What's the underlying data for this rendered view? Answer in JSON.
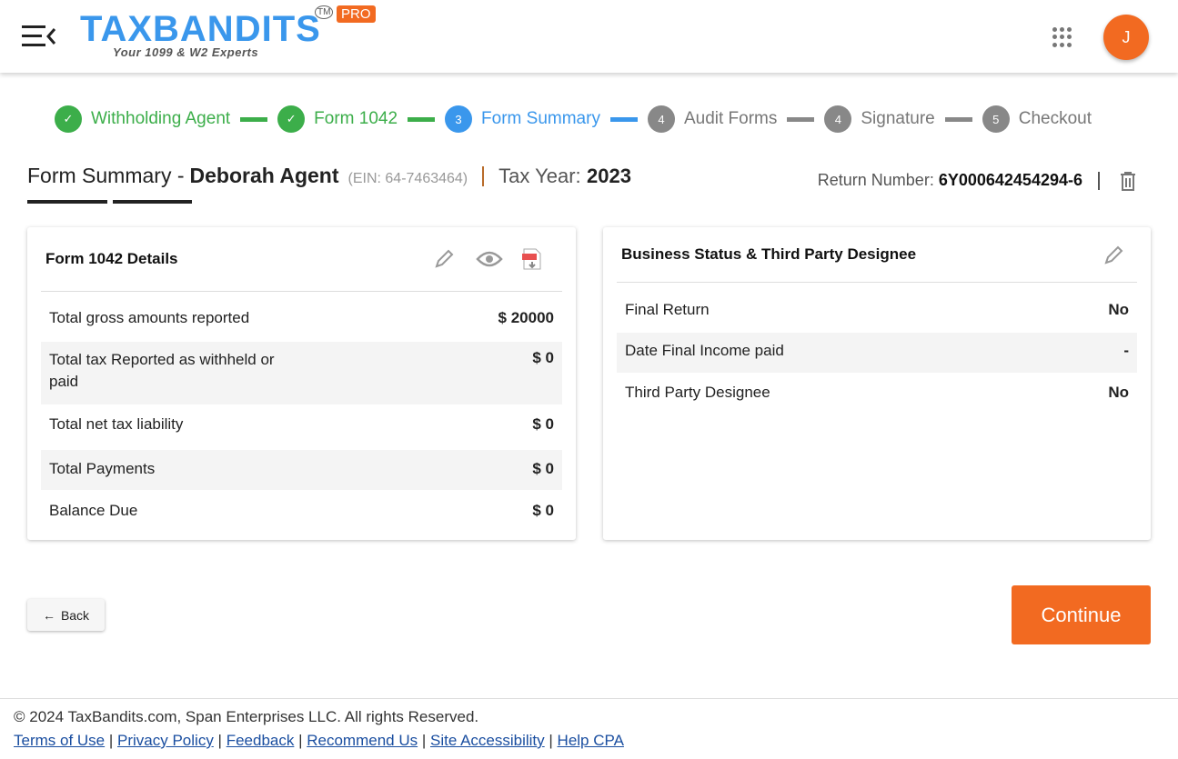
{
  "header": {
    "brand": "TAXBANDITS",
    "tagline": "Your 1099 & W2 Experts",
    "tm": "TM",
    "pro": "PRO",
    "avatar_initial": "J"
  },
  "steps": [
    {
      "label": "Withholding Agent",
      "num": "✓",
      "state": "done"
    },
    {
      "label": "Form 1042",
      "num": "✓",
      "state": "done"
    },
    {
      "label": "Form Summary",
      "num": "3",
      "state": "current"
    },
    {
      "label": "Audit Forms",
      "num": "4",
      "state": "todo"
    },
    {
      "label": "Signature",
      "num": "4",
      "state": "todo"
    },
    {
      "label": "Checkout",
      "num": "5",
      "state": "todo"
    }
  ],
  "title": {
    "prefix": "Form Summary -",
    "name": "Deborah Agent",
    "ein": "(EIN: 64-7463464)",
    "tax_year_label": "Tax Year:",
    "tax_year": "2023",
    "return_label": "Return Number:",
    "return_number": "6Y000642454294-6"
  },
  "details": {
    "title": "Form 1042 Details",
    "rows": [
      {
        "label": "Total gross amounts reported",
        "value": "$ 20000"
      },
      {
        "label": "Total tax Reported as withheld or paid",
        "value": "$ 0"
      },
      {
        "label": "Total net tax liability",
        "value": "$ 0"
      },
      {
        "label": "Total Payments",
        "value": "$ 0"
      },
      {
        "label": "Balance Due",
        "value": "$ 0"
      }
    ]
  },
  "status": {
    "title": "Business Status & Third Party Designee",
    "rows": [
      {
        "label": "Final Return",
        "value": "No"
      },
      {
        "label": "Date Final Income paid",
        "value": "-"
      },
      {
        "label": "Third Party Designee",
        "value": "No"
      }
    ]
  },
  "buttons": {
    "back": "Back",
    "continue": "Continue"
  },
  "footer": {
    "copyright": "© 2024 TaxBandits.com, Span Enterprises LLC. All rights Reserved.",
    "links": [
      "Terms of Use",
      "Privacy Policy",
      "Feedback",
      "Recommend Us",
      "Site Accessibility",
      "Help CPA"
    ]
  },
  "colors": {
    "accent": "#f26a21",
    "blue": "#3a97ec",
    "green": "#3cae4a"
  }
}
